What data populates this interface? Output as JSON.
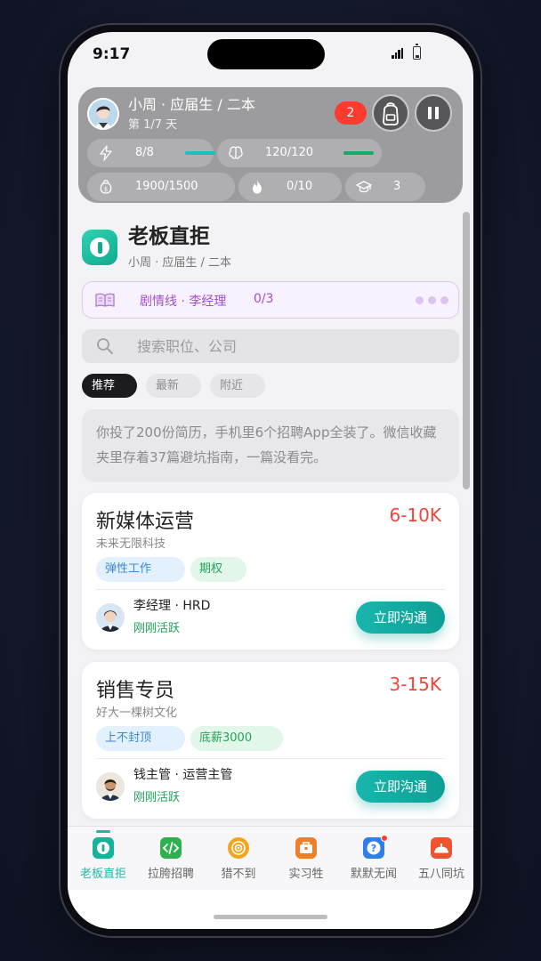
{
  "status": {
    "time": "9:17"
  },
  "hud": {
    "player": "小周 · 应届生 / 二本",
    "day": "第 1/7 天",
    "notifications": "2",
    "stats": [
      {
        "icon": "lightning-icon",
        "value": "8/8",
        "level": 1.0,
        "color": "#19c1bd"
      },
      {
        "icon": "brain-icon",
        "value": "120/120",
        "level": 1.0,
        "color": "#14ad67"
      },
      {
        "icon": "money-bag-icon",
        "value": "1900/1500"
      },
      {
        "icon": "fire-icon",
        "value": "0/10"
      },
      {
        "icon": "grad-cap-icon",
        "value": "3"
      }
    ]
  },
  "page": {
    "title": "老板直拒",
    "subtitle": "小周 · 应届生 / 二本",
    "storyline": {
      "label": "剧情线 · 李经理",
      "progress": "0/3"
    },
    "search": {
      "placeholder": "搜索职位、公司"
    },
    "chips": [
      "推荐",
      "最新",
      "附近"
    ],
    "intro": "你投了200份简历，手机里6个招聘App全装了。微信收藏夹里存着37篇避坑指南，一篇没看完。"
  },
  "jobs": [
    {
      "title": "新媒体运营",
      "salary": "6-10K",
      "company": "未来无限科技",
      "tags": [
        {
          "text": "弹性工作",
          "style": "blue"
        },
        {
          "text": "期权",
          "style": "green"
        }
      ],
      "recruiter": "李经理 · HRD",
      "status": "刚刚活跃",
      "action": "立即沟通"
    },
    {
      "title": "销售专员",
      "salary": "3-15K",
      "company": "好大一棵树文化",
      "tags": [
        {
          "text": "上不封顶",
          "style": "blue"
        },
        {
          "text": "底薪3000",
          "style": "green"
        }
      ],
      "recruiter": "钱主管 · 运营主管",
      "status": "刚刚活跃",
      "action": "立即沟通"
    }
  ],
  "tabs": [
    {
      "label": "老板直拒",
      "icon": "boss-app-icon",
      "color": "#15b39a",
      "active": true
    },
    {
      "label": "拉胯招聘",
      "icon": "code-app-icon",
      "color": "#2fb150"
    },
    {
      "label": "猎不到",
      "icon": "target-app-icon",
      "color": "#f4a41c"
    },
    {
      "label": "实习牲",
      "icon": "intern-app-icon",
      "color": "#f07f2a"
    },
    {
      "label": "默默无闻",
      "icon": "question-app-icon",
      "color": "#2f7fe8",
      "badge": true
    },
    {
      "label": "五八同坑",
      "icon": "fifty-eight-app-icon",
      "color": "#f0542d"
    }
  ]
}
